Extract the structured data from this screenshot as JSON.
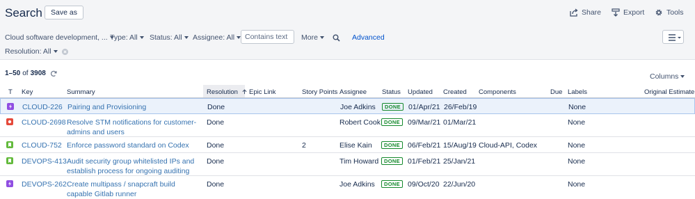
{
  "header": {
    "title": "Search",
    "save_as": "Save as",
    "actions": {
      "share": "Share",
      "export": "Export",
      "tools": "Tools"
    }
  },
  "filters": {
    "project": "Cloud software development, ...",
    "type": "Type: All",
    "status": "Status: All",
    "assignee": "Assignee: All",
    "text_placeholder": "Contains text",
    "more": "More",
    "advanced": "Advanced",
    "resolution": "Resolution: All"
  },
  "results": {
    "range": "1–50",
    "of": "of",
    "total": "3908",
    "columns_label": "Columns"
  },
  "table": {
    "headers": {
      "t": "T",
      "key": "Key",
      "summary": "Summary",
      "resolution": "Resolution",
      "epic_link": "Epic Link",
      "story_points": "Story Points",
      "assignee": "Assignee",
      "status": "Status",
      "updated": "Updated",
      "created": "Created",
      "components": "Components",
      "due": "Due",
      "labels": "Labels",
      "original_estimate": "Original Estimate"
    },
    "rows": [
      {
        "type_icon": "epic-icon",
        "type_color": "#904ee2",
        "key": "CLOUD-226",
        "summary": "Pairing and Provisioning",
        "resolution": "Done",
        "epic_link": "",
        "story_points": "",
        "assignee": "Joe Adkins",
        "status": "DONE",
        "updated": "01/Apr/21",
        "created": "26/Feb/19",
        "components": "",
        "due": "",
        "labels": "None",
        "original_estimate": ""
      },
      {
        "type_icon": "bug-icon",
        "type_color": "#e5493a",
        "key": "CLOUD-2698",
        "summary": "Resolve STM notifications for customer-admins and users",
        "resolution": "Done",
        "epic_link": "",
        "story_points": "",
        "assignee": "Robert Cook",
        "status": "DONE",
        "updated": "09/Mar/21",
        "created": "01/Mar/21",
        "components": "",
        "due": "",
        "labels": "None",
        "original_estimate": ""
      },
      {
        "type_icon": "story-icon",
        "type_color": "#63ba3c",
        "key": "CLOUD-752",
        "summary": "Enforce password standard on Codex",
        "resolution": "Done",
        "epic_link": "",
        "story_points": "2",
        "assignee": "Elise Kain",
        "status": "DONE",
        "updated": "06/Feb/21",
        "created": "15/Aug/19",
        "components": "Cloud-API, Codex",
        "due": "",
        "labels": "None",
        "original_estimate": ""
      },
      {
        "type_icon": "story-icon",
        "type_color": "#63ba3c",
        "key": "DEVOPS-413",
        "summary": "Audit security group whitelisted IPs and establish process for ongoing auditing",
        "resolution": "Done",
        "epic_link": "",
        "story_points": "",
        "assignee": "Tim Howard",
        "status": "DONE",
        "updated": "01/Feb/21",
        "created": "25/Jan/21",
        "components": "",
        "due": "",
        "labels": "None",
        "original_estimate": ""
      },
      {
        "type_icon": "epic-icon",
        "type_color": "#904ee2",
        "key": "DEVOPS-262",
        "summary": "Create multipass / snapcraft build capable Gitlab runner",
        "resolution": "Done",
        "epic_link": "",
        "story_points": "",
        "assignee": "Joe Adkins",
        "status": "DONE",
        "updated": "09/Oct/20",
        "created": "22/Jun/20",
        "components": "",
        "due": "",
        "labels": "None",
        "original_estimate": ""
      }
    ]
  }
}
